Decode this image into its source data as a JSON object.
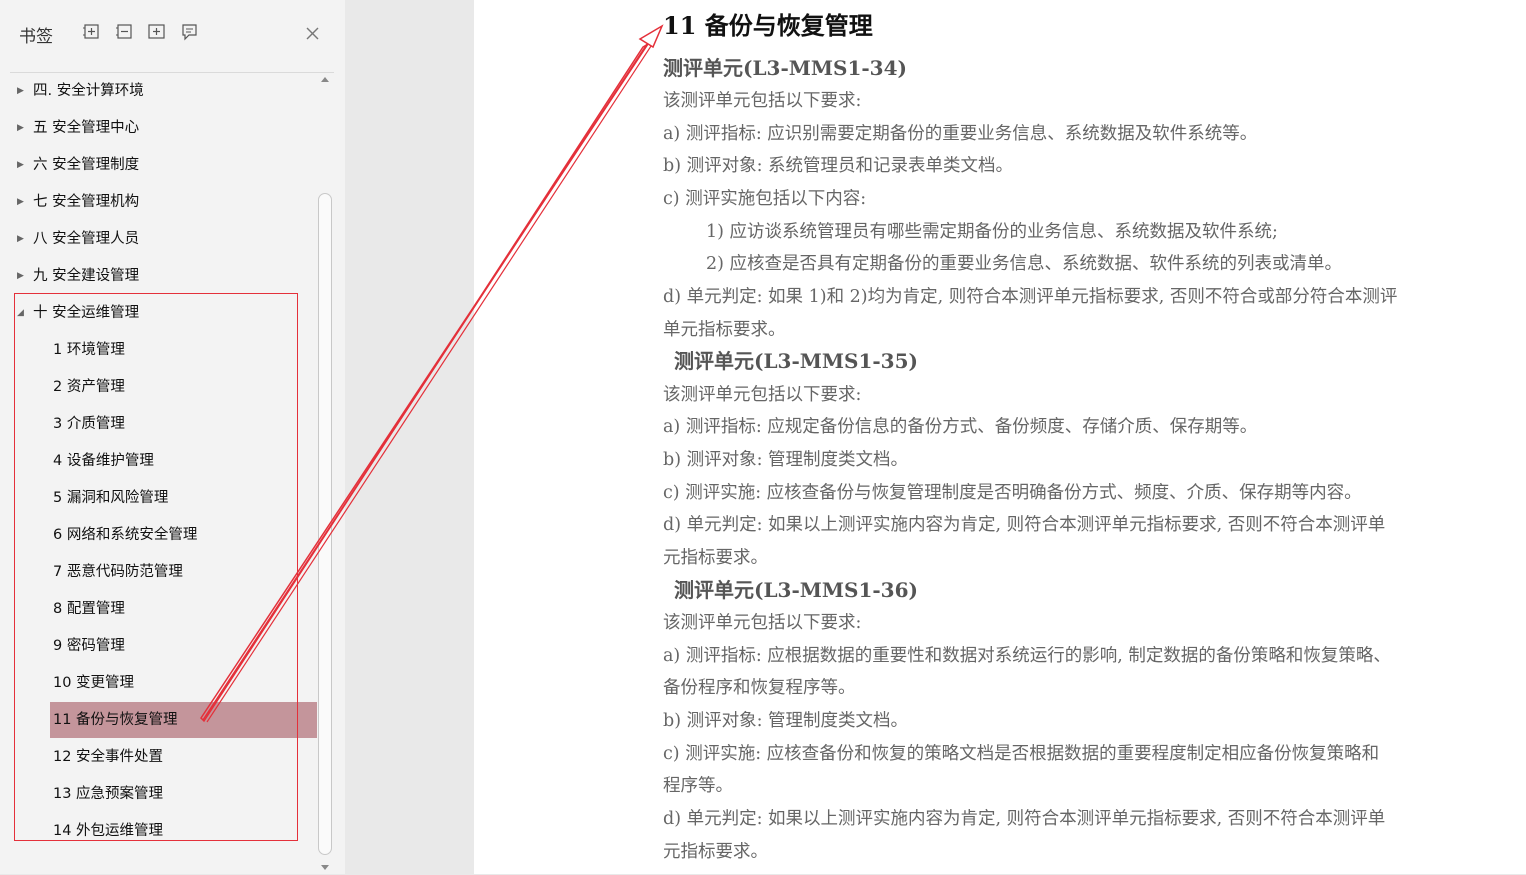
{
  "sidebar": {
    "title": "书签",
    "toolbar_icons": [
      "expand-all-icon",
      "collapse-all-icon",
      "add-bookmark-icon",
      "bookmark-icon"
    ],
    "close_icon": "close-icon",
    "items": [
      {
        "label": "四. 安全计算环境",
        "level": 0,
        "expanded": false
      },
      {
        "label": "五 安全管理中心",
        "level": 0,
        "expanded": false
      },
      {
        "label": "六 安全管理制度",
        "level": 0,
        "expanded": false
      },
      {
        "label": "七 安全管理机构",
        "level": 0,
        "expanded": false
      },
      {
        "label": "八 安全管理人员",
        "level": 0,
        "expanded": false
      },
      {
        "label": "九 安全建设管理",
        "level": 0,
        "expanded": false
      },
      {
        "label": "十 安全运维管理",
        "level": 0,
        "expanded": true
      },
      {
        "label": "1 环境管理",
        "level": 1
      },
      {
        "label": "2 资产管理",
        "level": 1
      },
      {
        "label": "3 介质管理",
        "level": 1
      },
      {
        "label": "4 设备维护管理",
        "level": 1
      },
      {
        "label": "5 漏洞和风险管理",
        "level": 1
      },
      {
        "label": "6 网络和系统安全管理",
        "level": 1
      },
      {
        "label": "7 恶意代码防范管理",
        "level": 1
      },
      {
        "label": "8 配置管理",
        "level": 1
      },
      {
        "label": "9 密码管理",
        "level": 1
      },
      {
        "label": "10 变更管理",
        "level": 1
      },
      {
        "label": "11 备份与恢复管理",
        "level": 1,
        "selected": true
      },
      {
        "label": "12 安全事件处置",
        "level": 1
      },
      {
        "label": "13 应急预案管理",
        "level": 1
      },
      {
        "label": "14 外包运维管理",
        "level": 1
      }
    ]
  },
  "document": {
    "heading": "11 备份与恢复管理",
    "unit1": {
      "title": "测评单元(L3-MMS1-34)",
      "intro": "该测评单元包括以下要求:",
      "a": "a) 测评指标: 应识别需要定期备份的重要业务信息、系统数据及软件系统等。",
      "b": "b) 测评对象: 系统管理员和记录表单类文档。",
      "c": "c) 测评实施包括以下内容:",
      "c1": "1) 应访谈系统管理员有哪些需定期备份的业务信息、系统数据及软件系统;",
      "c2": "2) 应核查是否具有定期备份的重要业务信息、系统数据、软件系统的列表或清单。",
      "d1": "d) 单元判定: 如果 1)和 2)均为肯定, 则符合本测评单元指标要求, 否则不符合或部分符合本测评",
      "d2": "单元指标要求。"
    },
    "unit2": {
      "title": "测评单元(L3-MMS1-35)",
      "intro": "该测评单元包括以下要求:",
      "a": "a) 测评指标: 应规定备份信息的备份方式、备份频度、存储介质、保存期等。",
      "b": "b) 测评对象: 管理制度类文档。",
      "c": "c) 测评实施: 应核查备份与恢复管理制度是否明确备份方式、频度、介质、保存期等内容。",
      "d1": "d) 单元判定: 如果以上测评实施内容为肯定, 则符合本测评单元指标要求, 否则不符合本测评单",
      "d2": "元指标要求。"
    },
    "unit3": {
      "title": "测评单元(L3-MMS1-36)",
      "intro": "该测评单元包括以下要求:",
      "a1": "a) 测评指标: 应根据数据的重要性和数据对系统运行的影响, 制定数据的备份策略和恢复策略、",
      "a2": "备份程序和恢复程序等。",
      "b": "b) 测评对象: 管理制度类文档。",
      "c1": "c) 测评实施: 应核查备份和恢复的策略文档是否根据数据的重要程度制定相应备份恢复策略和",
      "c2": "程序等。",
      "d1": "d) 单元判定: 如果以上测评实施内容为肯定, 则符合本测评单元指标要求, 否则不符合本测评单",
      "d2": "元指标要求。"
    }
  },
  "colors": {
    "selection": "#c4959b",
    "annotation": "#e4303a"
  }
}
